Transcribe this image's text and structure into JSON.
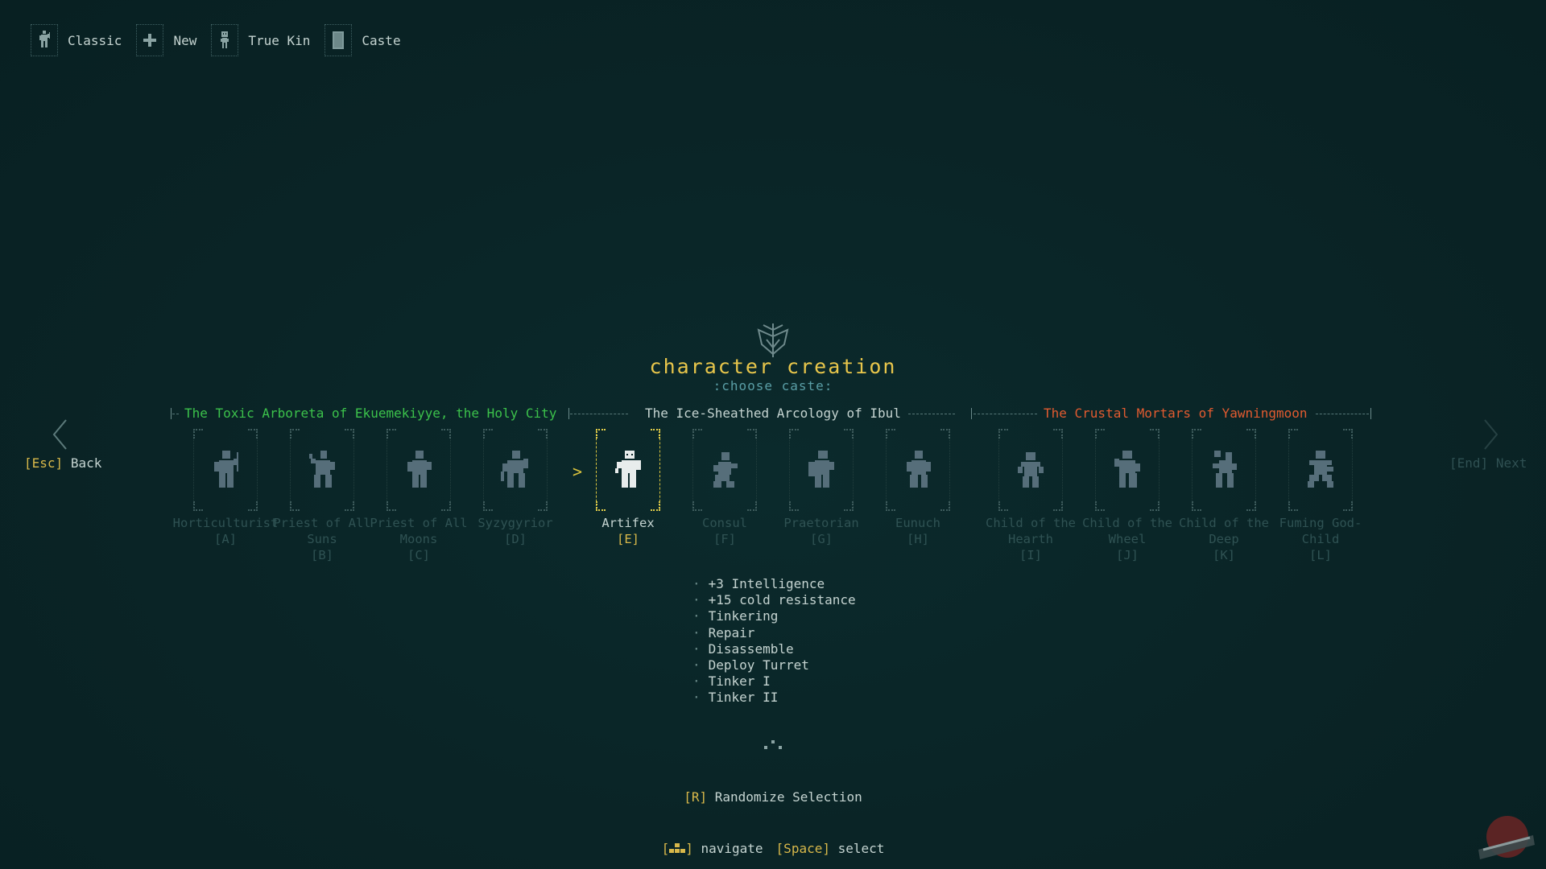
{
  "breadcrumb": [
    {
      "label": "Classic",
      "icon": "mutant-figure-icon"
    },
    {
      "label": "New",
      "icon": "plus-icon"
    },
    {
      "label": "True Kin",
      "icon": "true-kin-figure-icon"
    },
    {
      "label": "Caste",
      "icon": "card-icon"
    }
  ],
  "header": {
    "title": "character creation",
    "subtitle": ":choose caste:"
  },
  "regions": [
    {
      "label": "The Toxic Arboreta of Ekuemekiyye, the Holy City",
      "color": "#3cc24b"
    },
    {
      "label": "The Ice-Sheathed Arcology of Ibul",
      "color": "#c5d4d1"
    },
    {
      "label": "The Crustal Mortars of Yawningmoon",
      "color": "#e25b30"
    }
  ],
  "nav": {
    "back_key": "[Esc]",
    "back_label": "Back",
    "next_key": "[End]",
    "next_label": "Next"
  },
  "castes": [
    {
      "name": "Horticulturist",
      "hotkey": "[A]"
    },
    {
      "name": "Priest of All Suns",
      "hotkey": "[B]"
    },
    {
      "name": "Priest of All Moons",
      "hotkey": "[C]"
    },
    {
      "name": "Syzygyrior",
      "hotkey": "[D]"
    },
    {
      "name": "Artifex",
      "hotkey": "[E]",
      "selected": true
    },
    {
      "name": "Consul",
      "hotkey": "[F]"
    },
    {
      "name": "Praetorian",
      "hotkey": "[G]"
    },
    {
      "name": "Eunuch",
      "hotkey": "[H]"
    },
    {
      "name": "Child of the Hearth",
      "hotkey": "[I]"
    },
    {
      "name": "Child of the Wheel",
      "hotkey": "[J]"
    },
    {
      "name": "Child of the Deep",
      "hotkey": "[K]"
    },
    {
      "name": "Fuming God-Child",
      "hotkey": "[L]"
    }
  ],
  "selected_bonuses": [
    "+3 Intelligence",
    "+15 cold resistance",
    "Tinkering",
    "Repair",
    "Disassemble",
    "Deploy Turret",
    "Tinker I",
    "Tinker II"
  ],
  "randomize": {
    "key": "[R]",
    "label": "Randomize Selection"
  },
  "footer": {
    "navigate_key_open": "[",
    "navigate_key_close": "]",
    "navigate_label": "navigate",
    "select_key": "[Space]",
    "select_label": "select"
  },
  "colors": {
    "background": "#0a2426",
    "accent_yellow": "#e8c64b",
    "subtitle_teal": "#5a9ea6",
    "dim_text": "#2f5253"
  }
}
